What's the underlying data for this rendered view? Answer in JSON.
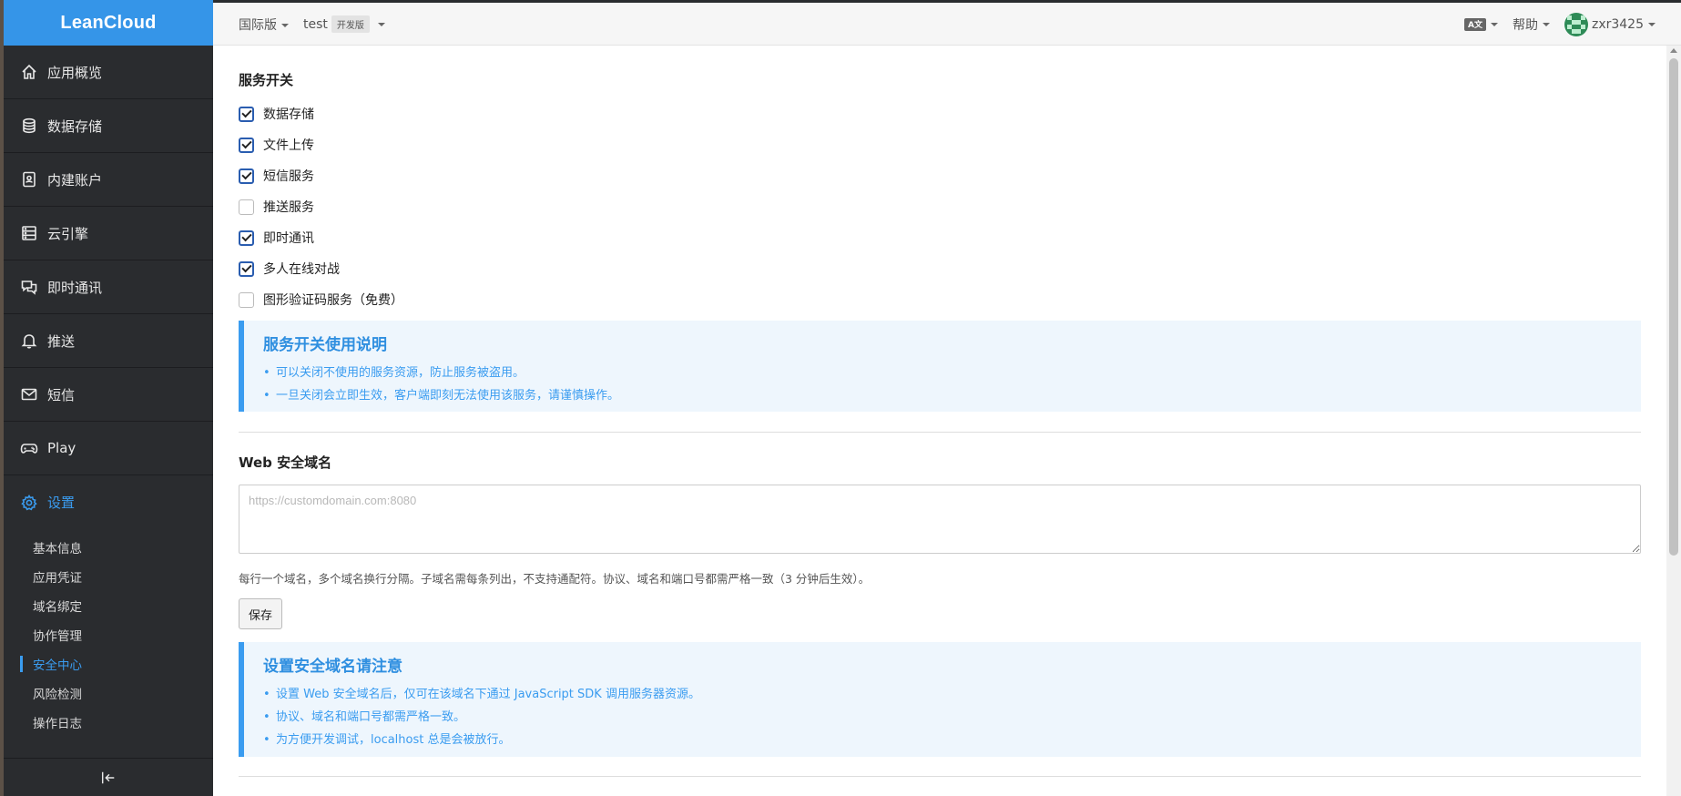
{
  "brand": "LeanCloud",
  "topbar": {
    "region": "国际版",
    "app_name": "test",
    "app_badge": "开发版",
    "lang_icon": "A文",
    "help": "帮助",
    "username": "zxr3425"
  },
  "sidebar": {
    "items": [
      {
        "label": "应用概览",
        "icon": "home-icon"
      },
      {
        "label": "数据存储",
        "icon": "database-icon"
      },
      {
        "label": "内建账户",
        "icon": "contact-card-icon"
      },
      {
        "label": "云引擎",
        "icon": "server-icon"
      },
      {
        "label": "即时通讯",
        "icon": "chat-icon"
      },
      {
        "label": "推送",
        "icon": "bell-icon"
      },
      {
        "label": "短信",
        "icon": "mail-icon"
      },
      {
        "label": "Play",
        "icon": "gamepad-icon"
      },
      {
        "label": "设置",
        "icon": "gear-icon",
        "active": true
      }
    ],
    "sub_items": [
      {
        "label": "基本信息"
      },
      {
        "label": "应用凭证"
      },
      {
        "label": "域名绑定"
      },
      {
        "label": "协作管理"
      },
      {
        "label": "安全中心",
        "active": true
      },
      {
        "label": "风险检测"
      },
      {
        "label": "操作日志"
      }
    ]
  },
  "service_switch": {
    "title": "服务开关",
    "options": [
      {
        "label": "数据存储",
        "checked": true
      },
      {
        "label": "文件上传",
        "checked": true
      },
      {
        "label": "短信服务",
        "checked": true
      },
      {
        "label": "推送服务",
        "checked": false
      },
      {
        "label": "即时通讯",
        "checked": true
      },
      {
        "label": "多人在线对战",
        "checked": true
      },
      {
        "label": "图形验证码服务（免费）",
        "checked": false
      }
    ],
    "notice": {
      "title": "服务开关使用说明",
      "items": [
        "可以关闭不使用的服务资源，防止服务被盗用。",
        "一旦关闭会立即生效，客户端即刻无法使用该服务，请谨慎操作。"
      ]
    }
  },
  "web_domain": {
    "title": "Web 安全域名",
    "input_value": "",
    "placeholder": "https://customdomain.com:8080",
    "help": "每行一个域名，多个域名换行分隔。子域名需每条列出，不支持通配符。协议、域名和端口号都需严格一致（3 分钟后生效）。",
    "save_label": "保存",
    "notice": {
      "title": "设置安全域名请注意",
      "items": [
        "设置 Web 安全域名后，仅可在该域名下通过 JavaScript SDK 调用服务器资源。",
        "协议、域名和端口号都需严格一致。",
        "为方便开发调试，localhost 总是会被放行。"
      ]
    }
  },
  "colors": {
    "brand": "#3595e8",
    "sidebar_bg": "#2a2c2f",
    "accent": "#3a9cf0",
    "notice_bg": "#eef6fd"
  }
}
